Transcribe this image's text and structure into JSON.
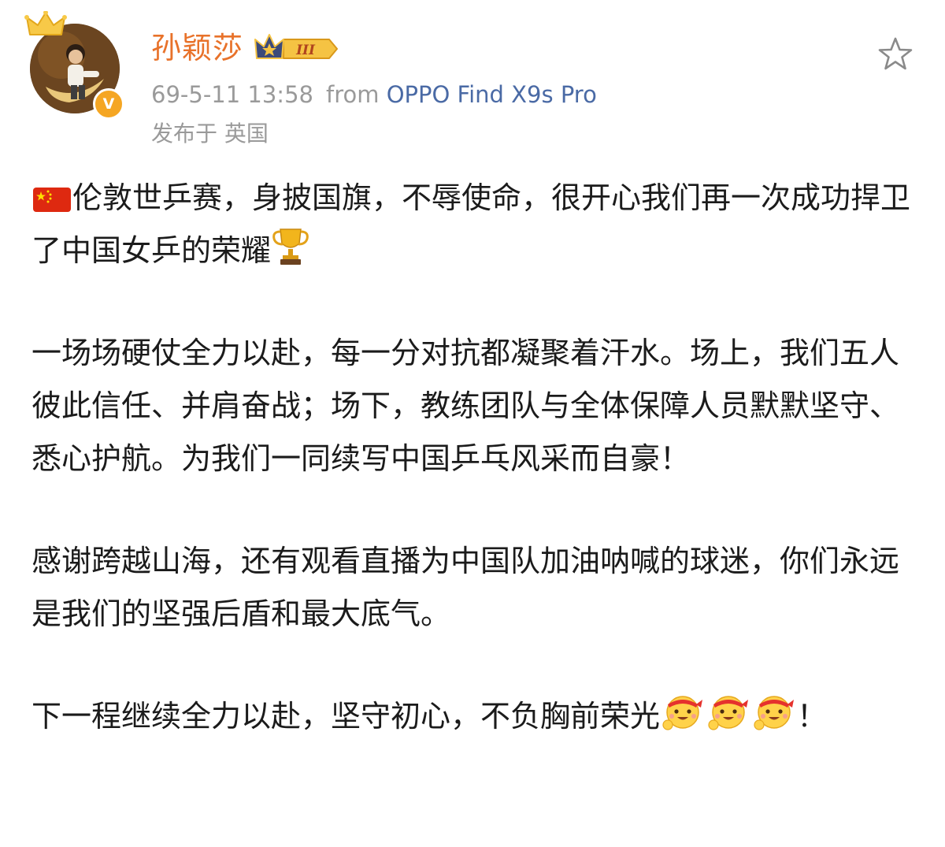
{
  "user": {
    "name": "孙颖莎",
    "rank_label": "III",
    "verified_label": "V"
  },
  "post_meta": {
    "time": "69-5-11 13:58",
    "from_label": "from",
    "device": "OPPO Find X9s Pro",
    "location": "发布于 英国"
  },
  "icons": {
    "flag": "china-flag-emoji",
    "trophy": "trophy-emoji",
    "cheer": "cheering-face-emoji",
    "star": "star-outline-icon"
  },
  "colors": {
    "username": "#e8722a",
    "device": "#4a6aa5",
    "meta": "#9a9a9a",
    "verified": "#f5a623"
  },
  "post": {
    "p1_text": "伦敦世乒赛，身披国旗，不辱使命，很开心我们再一次成功捍卫了中国女乒的荣耀",
    "p2": "一场场硬仗全力以赴，每一分对抗都凝聚着汗水。场上，我们五人彼此信任、并肩奋战；场下，教练团队与全体保障人员默默坚守、悉心护航。为我们一同续写中国乒乓风采而自豪！",
    "p3": "感谢跨越山海，还有观看直播为中国队加油呐喊的球迷，你们永远是我们的坚强后盾和最大底气。",
    "p4_text": "下一程继续全力以赴，坚守初心，不负胸前荣光",
    "p4_end": "！"
  }
}
